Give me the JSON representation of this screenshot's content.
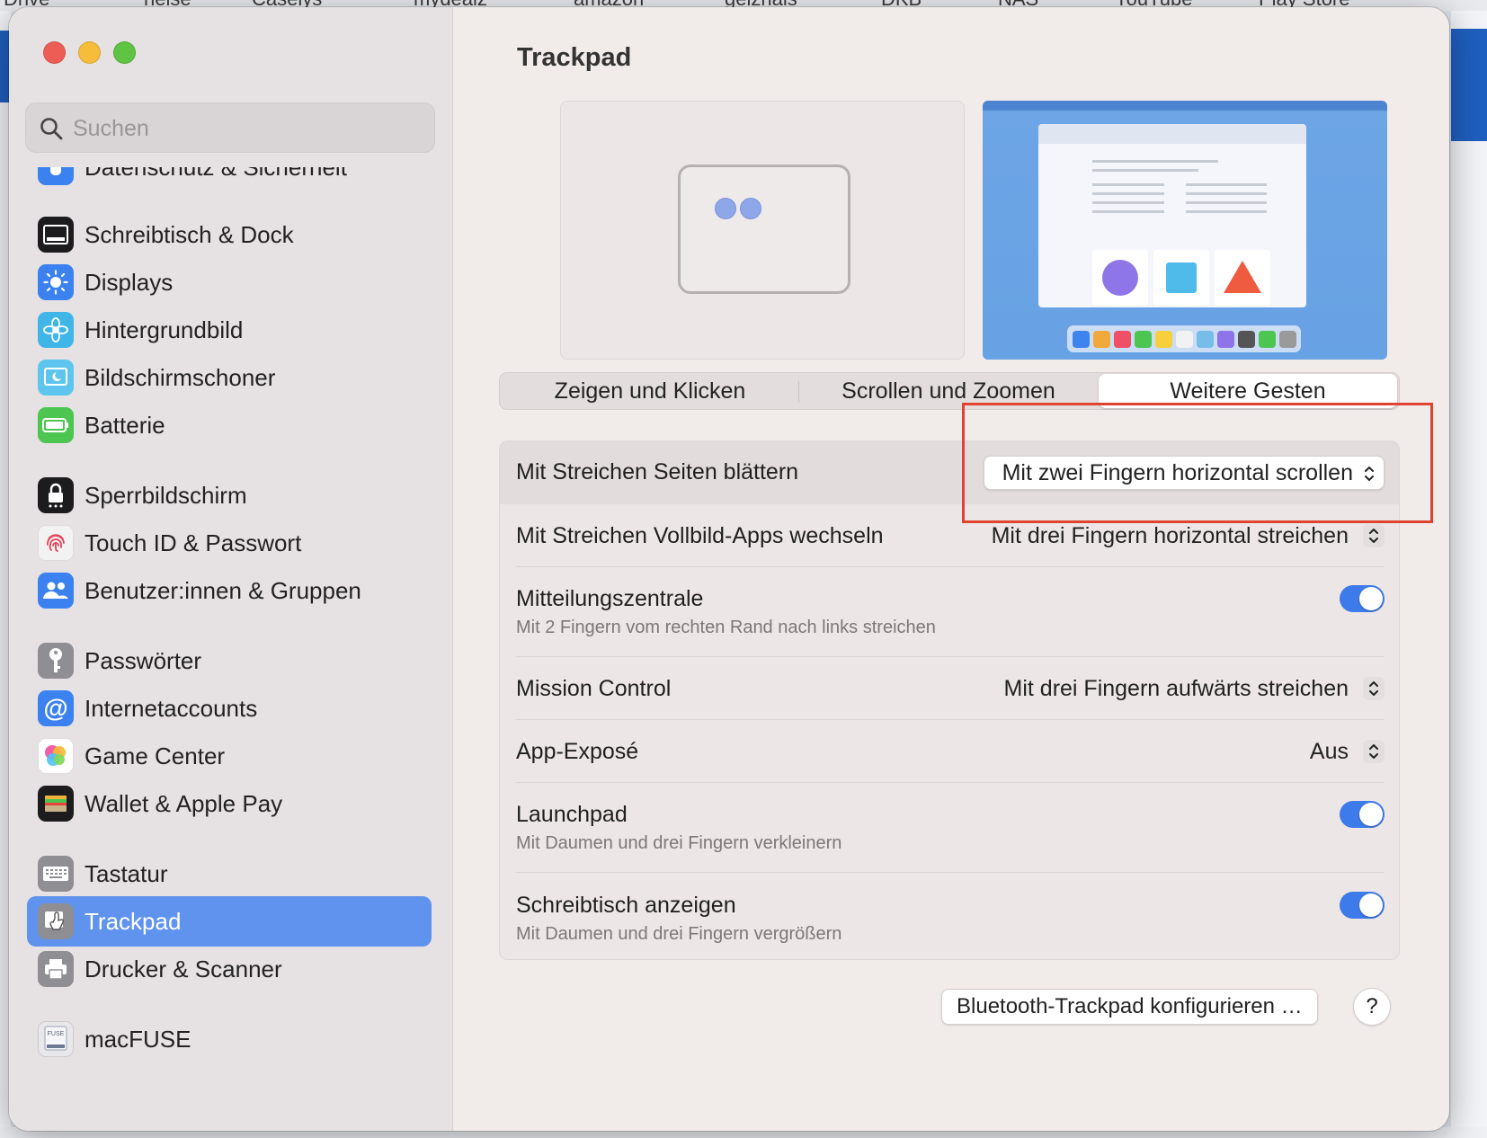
{
  "background": {
    "bookmarks": [
      "Drive",
      "heise",
      "Caseiys",
      "mydealz",
      "amazon",
      "geizhals",
      "DKB",
      "NAS",
      "YouTube",
      "Play Store"
    ]
  },
  "window": {
    "search_placeholder": "Suchen",
    "sidebar": {
      "partial_item": "Datenschutz & Sicherheit",
      "items": [
        {
          "label": "Schreibtisch & Dock",
          "icon": "dock-icon",
          "color": "#1c1c1e"
        },
        {
          "label": "Displays",
          "icon": "sun-icon",
          "color": "#3b82f0"
        },
        {
          "label": "Hintergrundbild",
          "icon": "flower-icon",
          "color": "#3fb5e8"
        },
        {
          "label": "Bildschirmschoner",
          "icon": "screensaver-icon",
          "color": "#5ec6ee"
        },
        {
          "label": "Batterie",
          "icon": "battery-icon",
          "color": "#4cc551"
        },
        {
          "label": "Sperrbildschirm",
          "icon": "lock-icon",
          "color": "#1c1c1e"
        },
        {
          "label": "Touch ID & Passwort",
          "icon": "fingerprint-icon",
          "color": "#f2f2f2"
        },
        {
          "label": "Benutzer:innen & Gruppen",
          "icon": "users-icon",
          "color": "#3b82f0"
        },
        {
          "label": "Passwörter",
          "icon": "key-icon",
          "color": "#8e8e93"
        },
        {
          "label": "Internetaccounts",
          "icon": "at-icon",
          "color": "#3b82f0"
        },
        {
          "label": "Game Center",
          "icon": "game-center-icon",
          "color": "#ffffff"
        },
        {
          "label": "Wallet & Apple Pay",
          "icon": "wallet-icon",
          "color": "#1c1c1e"
        },
        {
          "label": "Tastatur",
          "icon": "keyboard-icon",
          "color": "#8e8e93"
        },
        {
          "label": "Trackpad",
          "icon": "trackpad-icon",
          "color": "#8e8e93"
        },
        {
          "label": "Drucker & Scanner",
          "icon": "printer-icon",
          "color": "#8e8e93"
        },
        {
          "label": "macFUSE",
          "icon": "macfuse-icon",
          "color": "#e8e8ea"
        }
      ],
      "selected": "Trackpad"
    },
    "title": "Trackpad",
    "tabs": [
      "Zeigen und Klicken",
      "Scrollen und Zoomen",
      "Weitere Gesten"
    ],
    "active_tab": "Weitere Gesten",
    "rows": [
      {
        "label": "Mit Streichen Seiten blättern",
        "control": "popup",
        "value": "Mit zwei Fingern horizontal scrollen"
      },
      {
        "label": "Mit Streichen Vollbild-Apps wechseln",
        "control": "popup",
        "value": "Mit drei Fingern horizontal streichen"
      },
      {
        "label": "Mitteilungszentrale",
        "sub": "Mit 2 Fingern vom rechten Rand nach links streichen",
        "control": "toggle",
        "value": "on"
      },
      {
        "label": "Mission Control",
        "control": "popup",
        "value": "Mit drei Fingern aufwärts streichen"
      },
      {
        "label": "App-Exposé",
        "control": "popup",
        "value": "Aus"
      },
      {
        "label": "Launchpad",
        "sub": "Mit Daumen und drei Fingern verkleinern",
        "control": "toggle",
        "value": "on"
      },
      {
        "label": "Schreibtisch anzeigen",
        "sub": "Mit Daumen und drei Fingern vergrößern",
        "control": "toggle",
        "value": "on"
      }
    ],
    "bluetooth_button": "Bluetooth-Trackpad konfigurieren …",
    "help_button": "?"
  },
  "colors": {
    "accent": "#3e7bea",
    "selection": "#5f93ee",
    "annotation": "#e0432f"
  }
}
